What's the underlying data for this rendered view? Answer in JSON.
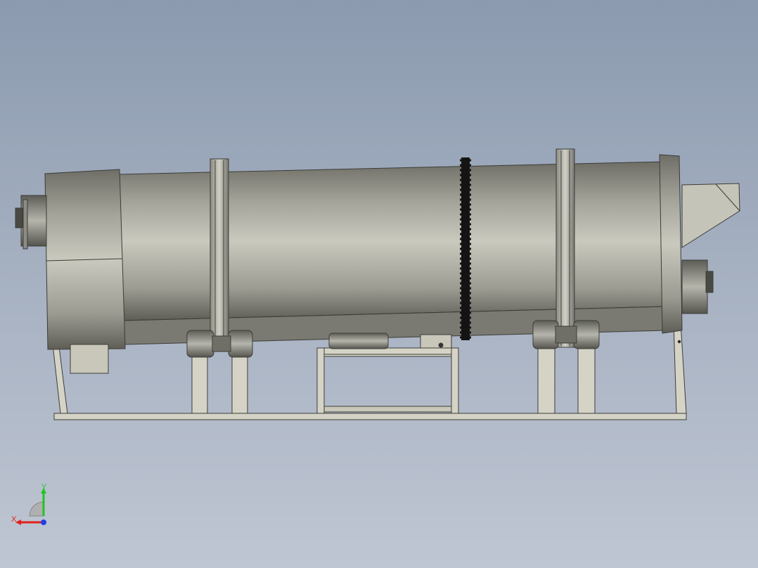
{
  "viewport": {
    "background_top": "#8b9aaf",
    "background_bottom": "#bfc6d3",
    "model": "rotary-drum-dryer",
    "view": "front"
  },
  "triad": {
    "x_label": "X",
    "y_label": "Y",
    "x_color": "#e3201b",
    "y_color": "#21c421",
    "z_color": "#2040e0"
  },
  "colors": {
    "shell_light": "#c8c8bc",
    "shell_dark": "#6b6b63",
    "frame": "#d4d3c6",
    "outline": "#3c3c38",
    "gear": "#111111"
  }
}
